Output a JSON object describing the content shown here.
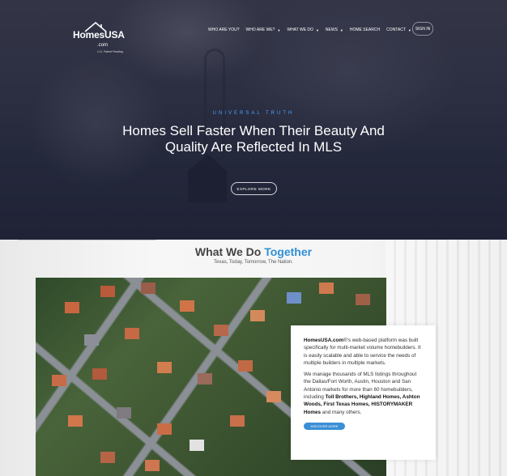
{
  "brand": {
    "logo_text": "HomesUSA",
    "logo_suffix": ".com",
    "patent_note": "U.S. Patent Pending"
  },
  "nav": {
    "items": [
      {
        "label": "WHO ARE YOU?",
        "dropdown": false
      },
      {
        "label": "WHO ARE WE?",
        "dropdown": true
      },
      {
        "label": "WHAT WE DO",
        "dropdown": true
      },
      {
        "label": "NEWS",
        "dropdown": true
      },
      {
        "label": "HOME SEARCH",
        "dropdown": false
      },
      {
        "label": "CONTACT",
        "dropdown": true
      }
    ],
    "signin_label": "SIGN IN"
  },
  "hero": {
    "eyebrow": "UNIVERSAL TRUTH",
    "headline_line1": "Homes Sell Faster When Their Beauty And",
    "headline_line2": "Quality Are Reflected In MLS",
    "cta_label": "EXPLORE MORE"
  },
  "section": {
    "title_plain": "What We Do",
    "title_accent": "Together",
    "subtitle": "Texas, Today, Tomorrow, The Nation."
  },
  "info": {
    "p1_brand": "HomesUSA.com",
    "p1_text": "®'s web-based platform was built specifically for multi-market volume homebuilders. It is easily scalable and able to service the needs of multiple builders in multiple markets.",
    "p2_text_a": "We manage thousands of MLS listings throughout the Dallas/Fort Worth, Austin, Houston and San Antonio markets for more than 60 homebuilders, including",
    "p2_bold": "Toll Brothers, Highland Homes, Ashton Woods, First Texas Homes, HISTORYMAKER Homes",
    "p2_text_b": "and many others.",
    "button_label": "DISCOVER MORE"
  },
  "colors": {
    "accent_blue": "#2f8fd8",
    "eyebrow_blue": "#4aa3ff",
    "button_blue": "#3a8fd6"
  }
}
